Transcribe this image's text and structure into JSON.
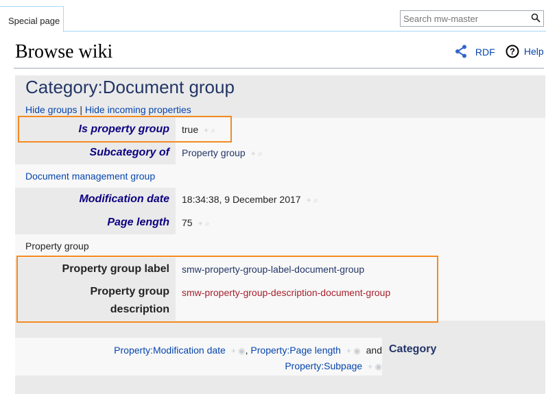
{
  "tab": {
    "label": "Special page"
  },
  "search": {
    "placeholder": "Search mw-master"
  },
  "page": {
    "title": "Browse wiki"
  },
  "tools": {
    "rdf": "RDF",
    "help": "Help"
  },
  "subject": {
    "title": "Category:Document group"
  },
  "toplinks": {
    "hide_groups": "Hide groups",
    "separator": "|",
    "hide_incoming": "Hide incoming properties"
  },
  "rows": {
    "is_property_group": {
      "label": "Is property group",
      "value": "true",
      "actions": "+ ⌕"
    },
    "subcategory_of": {
      "label": "Subcategory of",
      "value": "Property group",
      "actions": "+ ⌕"
    },
    "group_heading_1": "Document management group",
    "modification_date": {
      "label": "Modification date",
      "value": "18:34:38, 9 December 2017",
      "actions": "+ ⌕"
    },
    "page_length": {
      "label": "Page length",
      "value": "75",
      "actions": "+ ⌕"
    },
    "group_heading_2": "Property group",
    "property_group_label": {
      "label": "Property group label",
      "value": "smw-property-group-label-document-group"
    },
    "property_group_description": {
      "label_line1": "Property group",
      "label_line2": "description",
      "value": "smw-property-group-description-document-group"
    }
  },
  "incoming": {
    "prop1": "Property:Modification date",
    "comma": ",",
    "prop2": "Property:Page length",
    "and": "and",
    "prop3": "Property:Subpage",
    "actions": "+ ◉",
    "target": "Category"
  },
  "colors": {
    "link": "#0645ad",
    "highlight": "#f58a1f",
    "redlink": "#a61f2b",
    "title": "#233566"
  }
}
